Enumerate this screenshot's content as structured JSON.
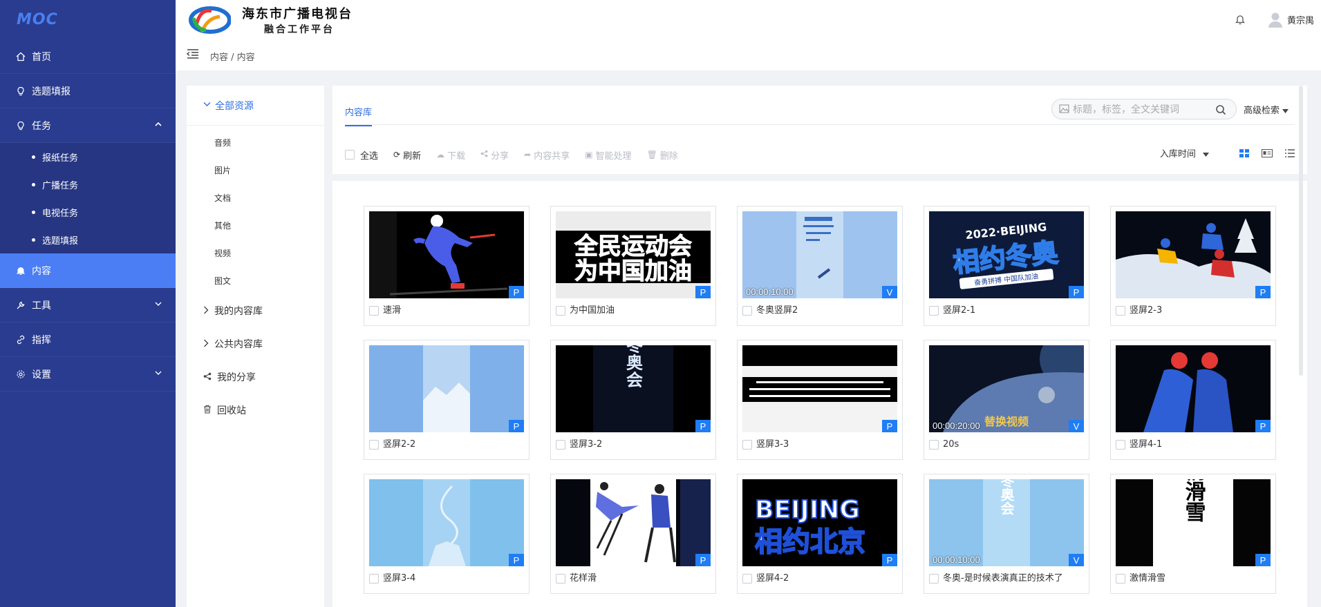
{
  "app": {
    "logo": "MOC"
  },
  "sidebar": {
    "items": [
      {
        "label": "首页",
        "icon": "home-icon"
      },
      {
        "label": "选题填报",
        "icon": "bulb-icon"
      },
      {
        "label": "任务",
        "icon": "bulb-icon",
        "expanded": true,
        "children": [
          "报纸任务",
          "广播任务",
          "电视任务",
          "选题填报"
        ]
      },
      {
        "label": "内容",
        "icon": "bell-icon",
        "active": true
      },
      {
        "label": "工具",
        "icon": "wrench-icon",
        "collapsible": true
      },
      {
        "label": "指挥",
        "icon": "link-icon"
      },
      {
        "label": "设置",
        "icon": "gear-icon",
        "collapsible": true
      }
    ]
  },
  "header": {
    "org_name": "海东市广播电视台",
    "platform_name": "融合工作平台",
    "breadcrumb": "内容 / 内容",
    "username": "黄宗禺"
  },
  "resources": {
    "root_label": "全部资源",
    "types": [
      "音频",
      "图片",
      "文档",
      "其他",
      "视频",
      "图文"
    ],
    "groups": [
      {
        "label": "我的内容库",
        "icon": "chevron-right-icon"
      },
      {
        "label": "公共内容库",
        "icon": "chevron-right-icon"
      },
      {
        "label": "我的分享",
        "icon": "share-icon"
      },
      {
        "label": "回收站",
        "icon": "trash-icon"
      }
    ]
  },
  "main": {
    "tab_label": "内容库",
    "search_placeholder": "标题，标签，全文关键词",
    "advanced_search": "高级检索",
    "toolbar": {
      "select_all": "全选",
      "refresh": "刷新",
      "download": "下载",
      "share": "分享",
      "content_share": "内容共享",
      "smart_process": "智能处理",
      "delete": "删除"
    },
    "sort_label": "入库时间",
    "accent": "#1f7df5"
  },
  "items": [
    {
      "title": "速滑",
      "type": "P"
    },
    {
      "title": "为中国加油",
      "type": "P"
    },
    {
      "title": "冬奥竖屏2",
      "type": "V",
      "duration": "00:00:10:00"
    },
    {
      "title": "竖屏2-1",
      "type": "P"
    },
    {
      "title": "竖屏2-3",
      "type": "P"
    },
    {
      "title": "竖屏2-2",
      "type": "P"
    },
    {
      "title": "竖屏3-2",
      "type": "P"
    },
    {
      "title": "竖屏3-3",
      "type": "P"
    },
    {
      "title": "20s",
      "type": "V",
      "duration": "00:00:20:00"
    },
    {
      "title": "竖屏4-1",
      "type": "P"
    },
    {
      "title": "竖屏3-4",
      "type": "P"
    },
    {
      "title": "花样滑",
      "type": "P"
    },
    {
      "title": "竖屏4-2",
      "type": "P"
    },
    {
      "title": "冬奥-是时候表演真正的技术了",
      "type": "V",
      "duration": "00:00:10:00"
    },
    {
      "title": "激情滑雪",
      "type": "P"
    }
  ],
  "thumb_texts": {
    "t1_line1": "全民运动会",
    "t1_line2": "为中国加油",
    "t3_year": "2022·BEIJING",
    "t3_main": "相约冬奥",
    "t3_sub": "奋勇拼搏 中国队加油",
    "t6_main": "北京冬奥会",
    "t8_caption": "替换视频",
    "t12_line1": "BEIJING",
    "t12_line2": "相约北京",
    "t14_main": "激情滑雪"
  }
}
